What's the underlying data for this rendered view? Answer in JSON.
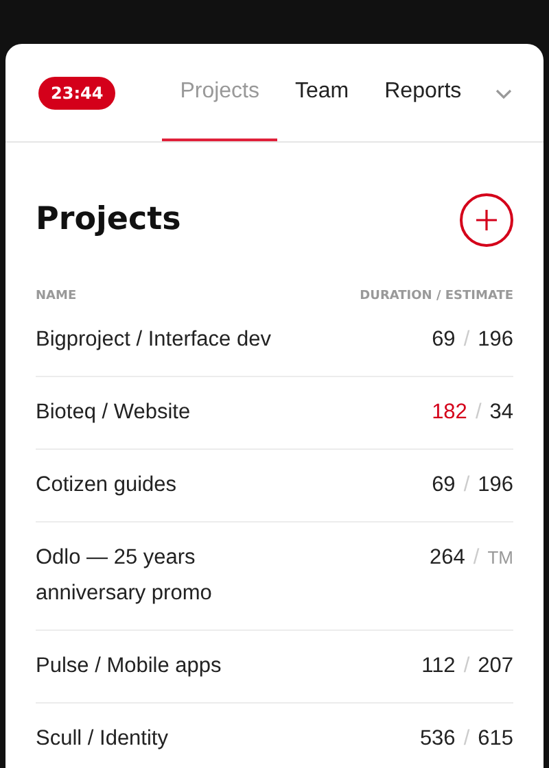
{
  "timer": "23:44",
  "tabs": [
    {
      "label": "Projects",
      "selected": true
    },
    {
      "label": "Team",
      "selected": false
    },
    {
      "label": "Reports",
      "selected": false
    }
  ],
  "title": "Projects",
  "table": {
    "columns": [
      "NAME",
      "DURATION / ESTIMATE"
    ],
    "rows": [
      {
        "name": "Bigproject / Interface dev",
        "duration": "69",
        "separator": "/",
        "estimate": "196",
        "over": false,
        "estimate_muted": false
      },
      {
        "name": "Bioteq / Website",
        "duration": "182",
        "separator": "/",
        "estimate": "34",
        "over": true,
        "estimate_muted": false
      },
      {
        "name": "Cotizen guides",
        "duration": "69",
        "separator": "/",
        "estimate": "196",
        "over": false,
        "estimate_muted": false
      },
      {
        "name": "Odlo — 25 years anniversary promo",
        "duration": "264",
        "separator": "/",
        "estimate": "TM",
        "over": false,
        "estimate_muted": true
      },
      {
        "name": "Pulse / Mobile apps",
        "duration": "112",
        "separator": "/",
        "estimate": "207",
        "over": false,
        "estimate_muted": false
      },
      {
        "name": "Scull / Identity",
        "duration": "536",
        "separator": "/",
        "estimate": "615",
        "over": false,
        "estimate_muted": false
      }
    ]
  }
}
